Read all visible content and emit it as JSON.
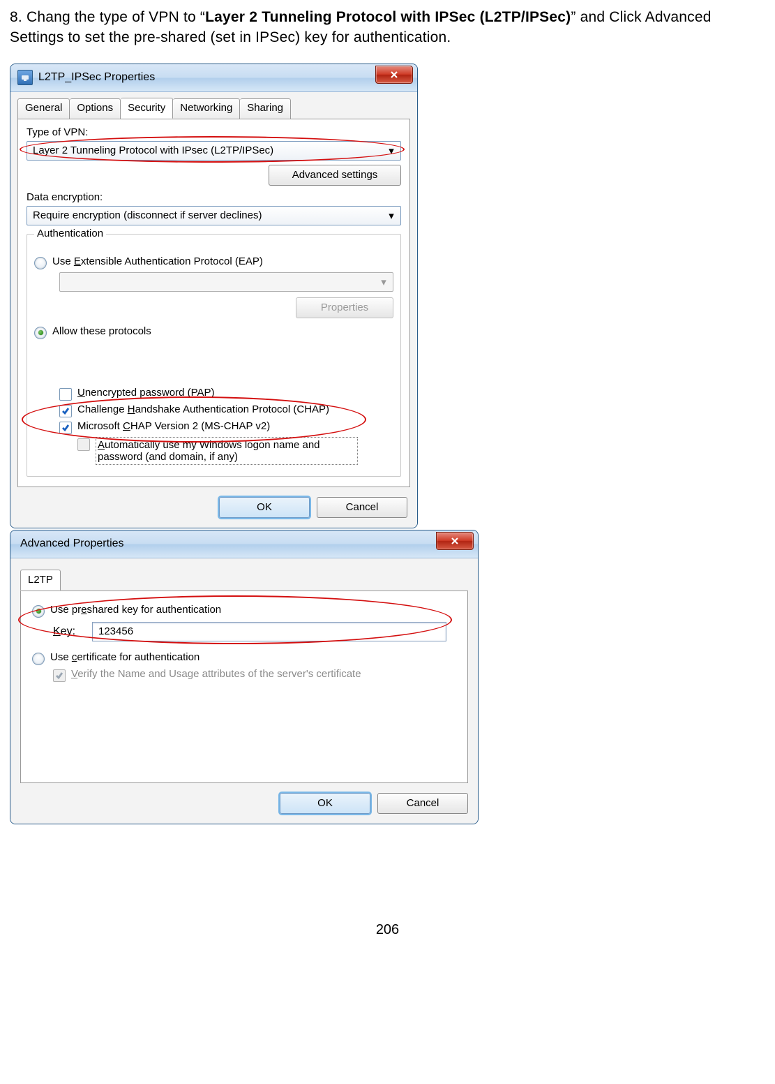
{
  "instruction": {
    "prefix": "8. Chang the type of VPN to “",
    "bold": "Layer 2 Tunneling Protocol with IPSec (L2TP/IPSec)",
    "suffix": "” and Click Advanced Settings to set the pre-shared (set in IPSec) key for authentication."
  },
  "dialog1": {
    "title": "L2TP_IPSec Properties",
    "tabs": [
      "General",
      "Options",
      "Security",
      "Networking",
      "Sharing"
    ],
    "selected_tab": "Security",
    "type_of_vpn_label": "Type of VPN:",
    "type_of_vpn_value": "Layer 2 Tunneling Protocol with IPsec (L2TP/IPSec)",
    "advanced_btn": "Advanced settings",
    "data_encryption_label": "Data encryption:",
    "data_encryption_value": "Require encryption (disconnect if server declines)",
    "auth_legend": "Authentication",
    "eap_label": "Use Extensible Authentication Protocol (EAP)",
    "properties_btn": "Properties",
    "allow_label": "Allow these protocols",
    "pap_label": "Unencrypted password (PAP)",
    "chap_label": "Challenge Handshake Authentication Protocol (CHAP)",
    "mschap_label": "Microsoft CHAP Version 2 (MS-CHAP v2)",
    "autologon_label": "Automatically use my Windows logon name and password (and domain, if any)",
    "ok": "OK",
    "cancel": "Cancel"
  },
  "dialog2": {
    "title": "Advanced Properties",
    "tab": "L2TP",
    "psk_label": "Use preshared key for authentication",
    "key_label": "Key:",
    "key_value": "123456",
    "cert_label": "Use certificate for authentication",
    "verify_label": "Verify the Name and Usage attributes of the server's certificate",
    "ok": "OK",
    "cancel": "Cancel"
  },
  "page_number": "206"
}
